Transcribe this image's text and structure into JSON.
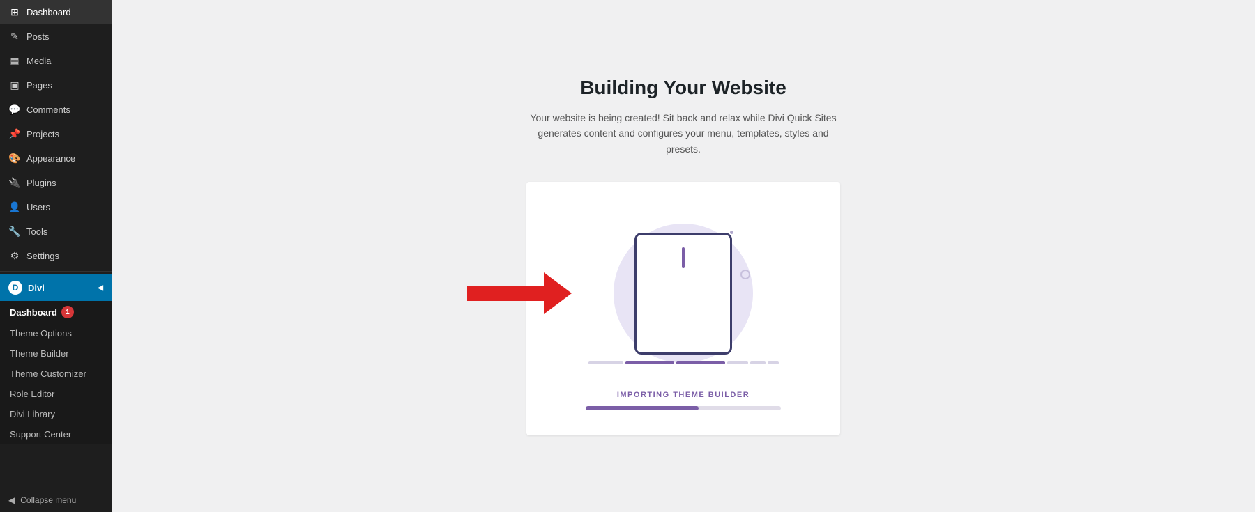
{
  "sidebar": {
    "items": [
      {
        "id": "dashboard",
        "label": "Dashboard",
        "icon": "⊞"
      },
      {
        "id": "posts",
        "label": "Posts",
        "icon": "✎"
      },
      {
        "id": "media",
        "label": "Media",
        "icon": "🖼"
      },
      {
        "id": "pages",
        "label": "Pages",
        "icon": "📄"
      },
      {
        "id": "comments",
        "label": "Comments",
        "icon": "💬"
      },
      {
        "id": "projects",
        "label": "Projects",
        "icon": "📌"
      },
      {
        "id": "appearance",
        "label": "Appearance",
        "icon": "🎨"
      },
      {
        "id": "plugins",
        "label": "Plugins",
        "icon": "🔌"
      },
      {
        "id": "users",
        "label": "Users",
        "icon": "👤"
      },
      {
        "id": "tools",
        "label": "Tools",
        "icon": "🔧"
      },
      {
        "id": "settings",
        "label": "Settings",
        "icon": "⚙"
      }
    ],
    "divi": {
      "label": "Divi",
      "submenu": [
        {
          "id": "divi-dashboard",
          "label": "Dashboard",
          "badge": "1"
        },
        {
          "id": "theme-options",
          "label": "Theme Options"
        },
        {
          "id": "theme-builder",
          "label": "Theme Builder"
        },
        {
          "id": "theme-customizer",
          "label": "Theme Customizer"
        },
        {
          "id": "role-editor",
          "label": "Role Editor"
        },
        {
          "id": "divi-library",
          "label": "Divi Library"
        },
        {
          "id": "support-center",
          "label": "Support Center"
        }
      ]
    },
    "collapse_label": "Collapse menu"
  },
  "main": {
    "title": "Building Your Website",
    "subtitle": "Your website is being created! Sit back and relax while Divi Quick Sites generates content and configures your menu, templates, styles and presets.",
    "status_label": "IMPORTING THEME BUILDER",
    "progress_percent": 58,
    "colors": {
      "purple": "#7b5ea7",
      "red_arrow": "#e02020",
      "progress_track": "#e0dce8"
    }
  }
}
